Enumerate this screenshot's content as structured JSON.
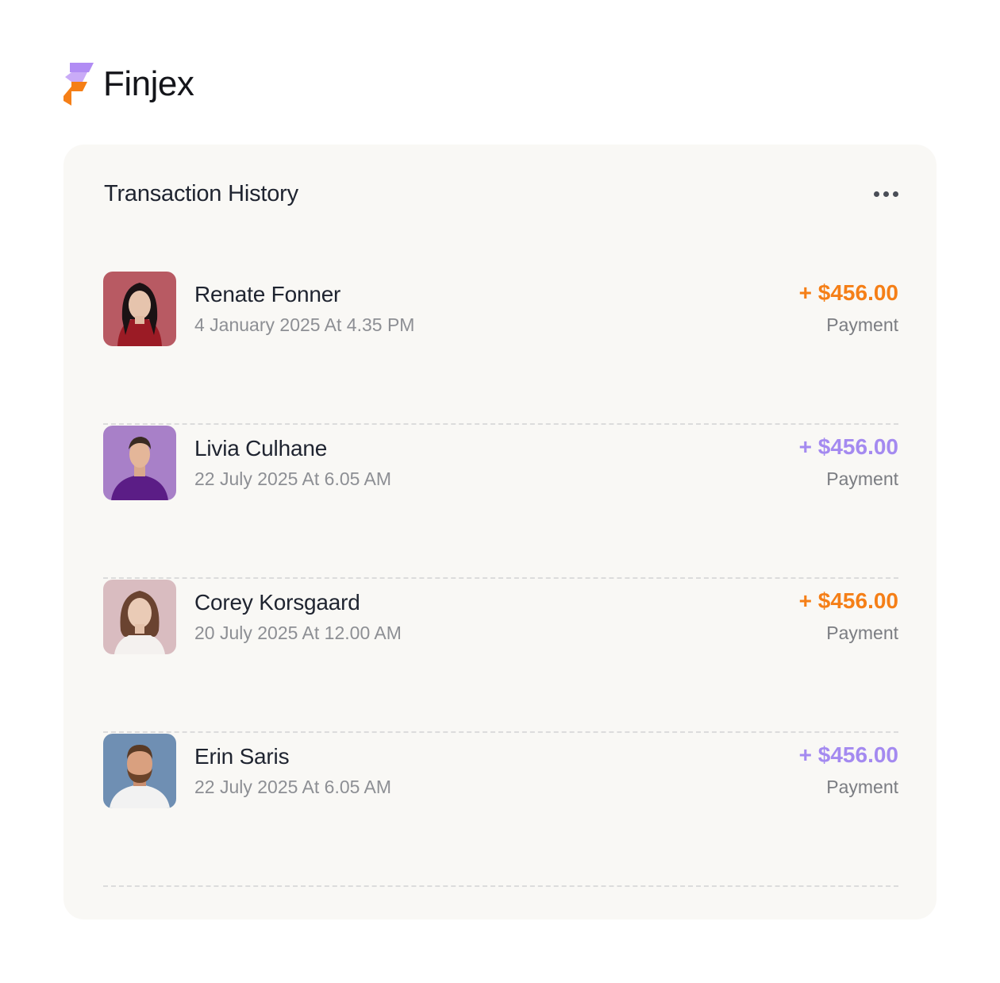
{
  "brand": {
    "name": "Finjex",
    "icon": "finjex-logo-icon",
    "colors": {
      "primary_purple": "#b18cf4",
      "primary_orange": "#f57f17"
    }
  },
  "card": {
    "title": "Transaction History",
    "more_icon": "more-horizontal-icon"
  },
  "transactions": [
    {
      "name": "Renate Fonner",
      "date": "4 January 2025 At 4.35 PM",
      "amount": "+ $456.00",
      "type": "Payment",
      "amount_color": "#f57f17",
      "avatar_bg": "#b85a63"
    },
    {
      "name": "Livia Culhane",
      "date": "22 July 2025 At 6.05 AM",
      "amount": "+ $456.00",
      "type": "Payment",
      "amount_color": "#a48af0",
      "avatar_bg": "#a880c8"
    },
    {
      "name": "Corey Korsgaard",
      "date": "20 July 2025 At 12.00 AM",
      "amount": "+ $456.00",
      "type": "Payment",
      "amount_color": "#f57f17",
      "avatar_bg": "#d9bcc0"
    },
    {
      "name": "Erin Saris",
      "date": "22 July 2025 At 6.05 AM",
      "amount": "+ $456.00",
      "type": "Payment",
      "amount_color": "#a48af0",
      "avatar_bg": "#6f8fb3"
    }
  ]
}
